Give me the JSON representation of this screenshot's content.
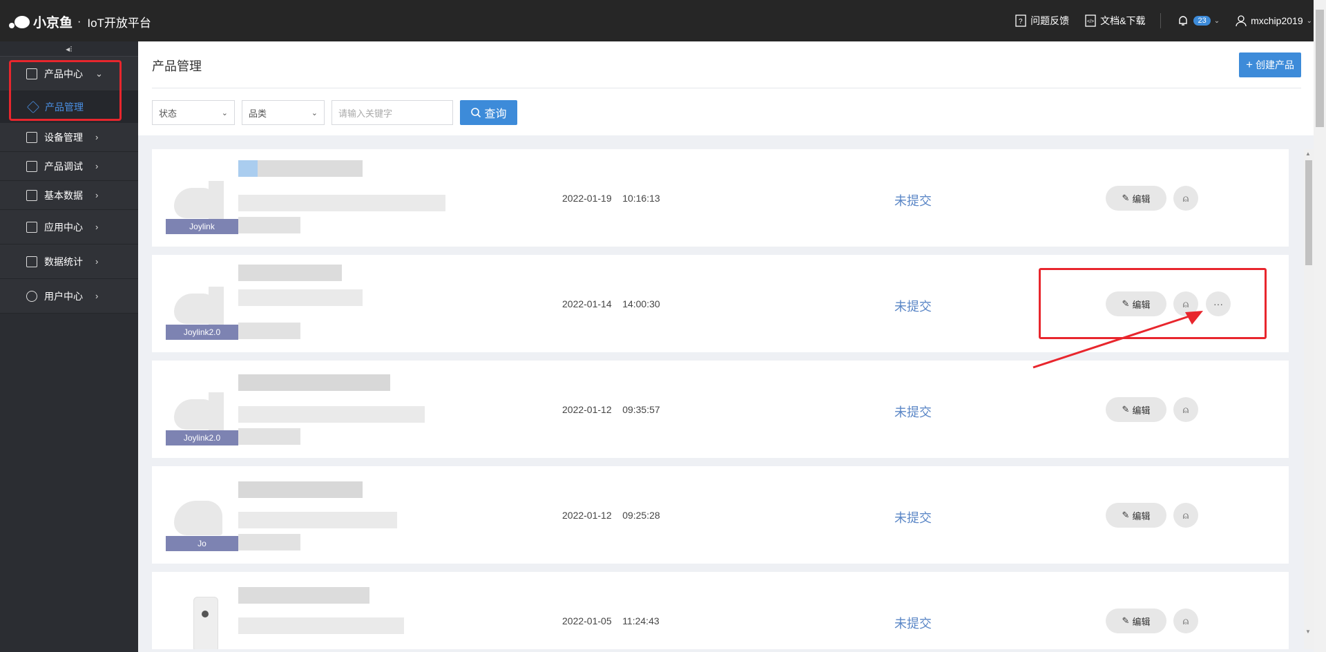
{
  "app": {
    "brand": "小京鱼",
    "separator": "·",
    "platform": "IoT开放平台"
  },
  "topbar": {
    "feedback_label": "问题反馈",
    "docs_label": "文档&下载",
    "notification_count": "23",
    "username": "mxchip2019"
  },
  "sidebar": {
    "collapse_icon": "collapse-arrows-icon",
    "items": [
      {
        "label": "产品中心",
        "icon": "grid-icon",
        "chevron": "⌄",
        "expanded": true
      },
      {
        "label": "产品管理",
        "icon": "cube-icon",
        "active": true
      },
      {
        "label": "设备管理",
        "icon": "monitor-icon",
        "chevron": "›"
      },
      {
        "label": "产品调试",
        "icon": "document-icon",
        "chevron": "›"
      },
      {
        "label": "基本数据",
        "icon": "bar-chart-icon",
        "chevron": "›"
      },
      {
        "label": "应用中心",
        "icon": "app-icon",
        "chevron": "›"
      },
      {
        "label": "数据统计",
        "icon": "stats-icon",
        "chevron": "›"
      },
      {
        "label": "用户中心",
        "icon": "user-icon",
        "chevron": "›"
      }
    ]
  },
  "page": {
    "title": "产品管理",
    "create_label": "创建产品"
  },
  "filters": {
    "status_label": "状态",
    "category_label": "品类",
    "keyword_placeholder": "请输入关键字",
    "query_label": "查询"
  },
  "products": [
    {
      "tag": "Joylink",
      "date": "2022-01-19",
      "time": "10:16:13",
      "status": "未提交",
      "edit_label": "编辑"
    },
    {
      "tag": "Joylink2.0",
      "date": "2022-01-14",
      "time": "14:00:30",
      "status": "未提交",
      "edit_label": "编辑",
      "more": "···"
    },
    {
      "tag": "Joylink2.0",
      "date": "2022-01-12",
      "time": "09:35:57",
      "status": "未提交",
      "edit_label": "编辑"
    },
    {
      "tag": "Jo",
      "date": "2022-01-12",
      "time": "09:25:28",
      "status": "未提交",
      "edit_label": "编辑"
    },
    {
      "tag": "",
      "date": "2022-01-05",
      "time": "11:24:43",
      "status": "未提交",
      "edit_label": "编辑"
    }
  ],
  "colors": {
    "accent": "#3d8bd9",
    "annotation": "#e8262d",
    "sidebar": "#2b2d32",
    "status": "#5a86c6"
  }
}
